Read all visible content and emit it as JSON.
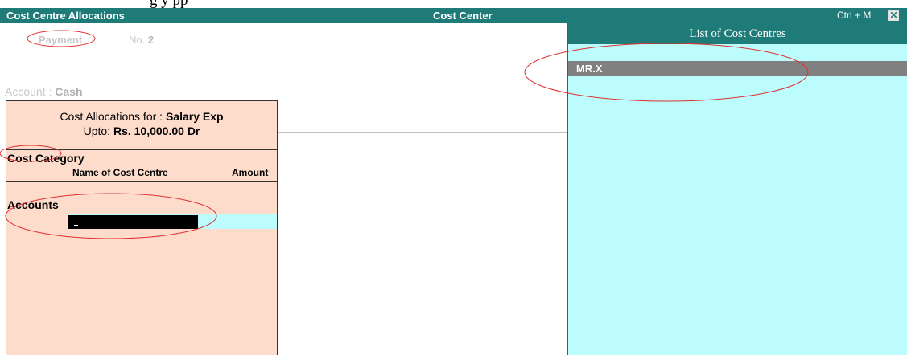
{
  "caption": "g        y                          pp",
  "titlebar": {
    "left_title": "Cost Centre Allocations",
    "center_title": "Cost Center",
    "shortcut": "Ctrl + M",
    "close_glyph": "✕"
  },
  "voucher": {
    "type": "Payment",
    "no_label": "No.",
    "no_value": "2",
    "account_label": "Account :",
    "account_value": "Cash"
  },
  "allocation": {
    "for_label": "Cost Allocations for :",
    "for_value": "Salary Exp",
    "upto_label": "Upto:",
    "upto_value": "Rs. 10,000.00 Dr",
    "cost_category_label": "Cost Category",
    "col_name": "Name of Cost Centre",
    "col_amount": "Amount",
    "category_value": "Accounts",
    "entry_value": ""
  },
  "cost_centre_list": {
    "title": "List of Cost Centres",
    "items": [
      "MR.X"
    ]
  },
  "colors": {
    "title_bar": "#1f7b78",
    "allocation_panel": "#fddccc",
    "list_panel": "#bdfcfc",
    "selected_item": "#808080",
    "annotation": "#e03030"
  }
}
